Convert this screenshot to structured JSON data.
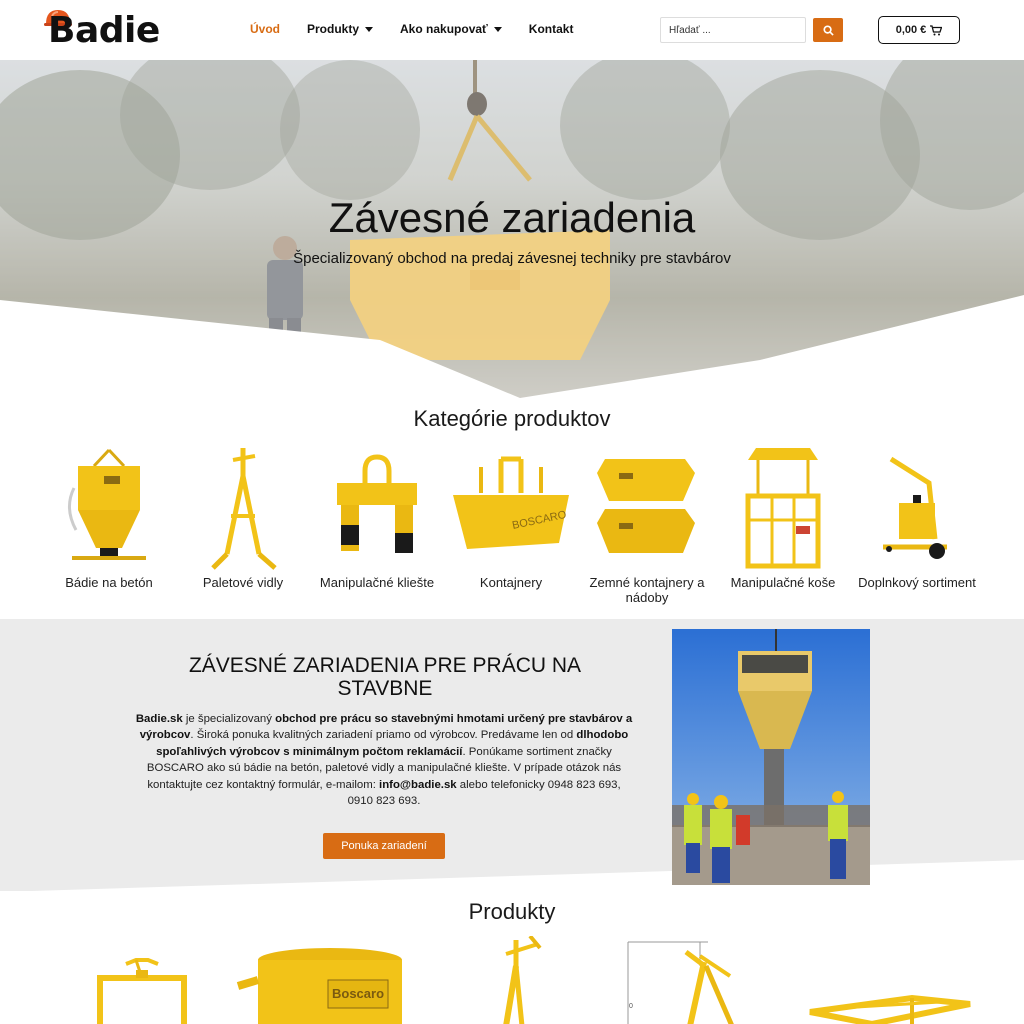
{
  "header": {
    "logo_text": "Badie",
    "nav": [
      {
        "label": "Úvod",
        "active": true,
        "dropdown": false
      },
      {
        "label": "Produkty",
        "active": false,
        "dropdown": true
      },
      {
        "label": "Ako nakupovať",
        "active": false,
        "dropdown": true
      },
      {
        "label": "Kontakt",
        "active": false,
        "dropdown": false
      }
    ],
    "search_placeholder": "Hľadať ...",
    "cart_total": "0,00 €"
  },
  "hero": {
    "title": "Závesné zariadenia",
    "subtitle": "Špecializovaný obchod na predaj závesnej techniky pre stavbárov"
  },
  "categories": {
    "title": "Kategórie produktov",
    "items": [
      {
        "label": "Bádie na betón",
        "icon": "concrete-bucket-icon"
      },
      {
        "label": "Paletové vidly",
        "icon": "pallet-fork-icon"
      },
      {
        "label": "Manipulačné kliešte",
        "icon": "clamp-icon"
      },
      {
        "label": "Kontajnery",
        "icon": "container-icon"
      },
      {
        "label": "Zemné kontajnery a nádoby",
        "icon": "earth-container-icon"
      },
      {
        "label": "Manipulačné koše",
        "icon": "basket-icon"
      },
      {
        "label": "Doplnkový sortiment",
        "icon": "accessory-icon"
      }
    ]
  },
  "info": {
    "title": "ZÁVESNÉ ZARIADENIA PRE PRÁCU NA STAVBNE",
    "p1_b1": "Badie.sk",
    "p1_t1": " je špecializovaný ",
    "p1_b2": "obchod pre prácu so stavebnými hmotami určený pre stavbárov a výrobcov",
    "p1_t2": ". Široká ponuka kvalitných zariadení priamo od výrobcov. Predávame len od ",
    "p1_b3": "dlhodobo spoľahlivých výrobcov s minimálnym počtom reklamácií",
    "p1_t3": ". Ponúkame sortiment značky BOSCARO ako sú bádie na betón, paletové vidly a manipulačné kliešte. V prípade otázok nás kontaktujte cez kontaktný formulár, e-mailom: ",
    "p1_b4": "info@badie.sk",
    "p1_t4": " alebo telefonicky 0948 823 693, 0910 823 693.",
    "button": "Ponuka zariadení"
  },
  "products": {
    "title": "Produkty"
  },
  "colors": {
    "accent": "#d86c14",
    "yellow": "#f2c318",
    "band": "#ebebeb"
  }
}
